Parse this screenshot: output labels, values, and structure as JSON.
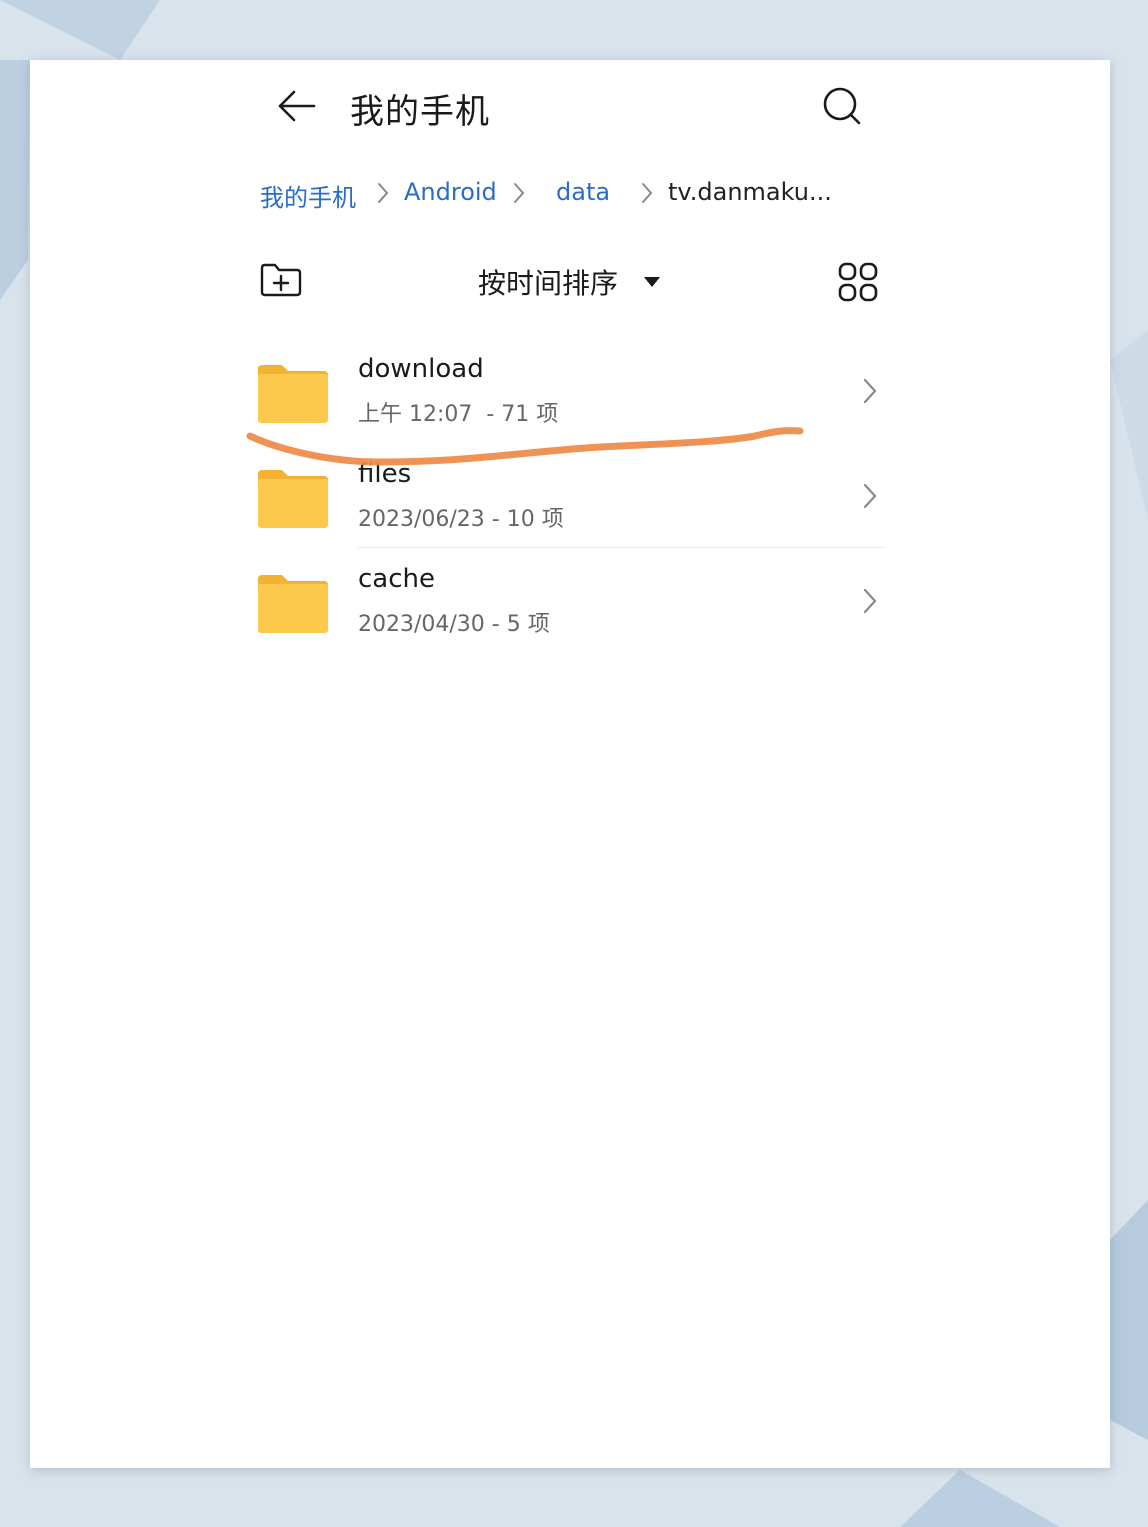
{
  "header": {
    "title": "我的手机",
    "back_icon": "arrow-left-icon",
    "search_icon": "search-icon"
  },
  "breadcrumb": {
    "items": [
      {
        "label": "我的手机"
      },
      {
        "label": "Android"
      },
      {
        "label": "data"
      },
      {
        "label": "tv.danmaku..."
      }
    ]
  },
  "toolbar": {
    "new_folder_icon": "new-folder-icon",
    "sort_label": "按时间排序",
    "grid_view_icon": "grid-view-icon"
  },
  "files": [
    {
      "name": "download",
      "meta": "上午 12:07  - 71 项"
    },
    {
      "name": "files",
      "meta": "2023/06/23 - 10 项"
    },
    {
      "name": "cache",
      "meta": "2023/04/30 - 5 项"
    }
  ],
  "colors": {
    "link": "#2a6cc9",
    "folder": "#fbc84a",
    "annotation": "#ee8a45"
  }
}
